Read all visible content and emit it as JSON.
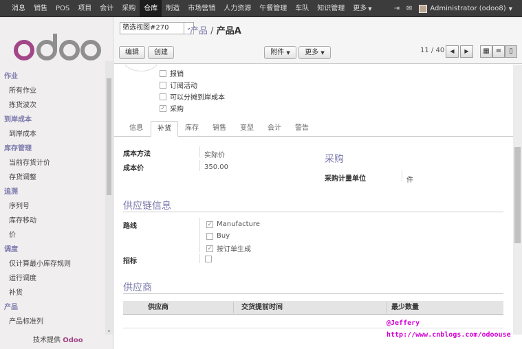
{
  "topnav": {
    "items": [
      "消息",
      "销售",
      "POS",
      "项目",
      "会计",
      "采购",
      "仓库",
      "制造",
      "市场营销",
      "人力资源",
      "午餐管理",
      "车队",
      "知识管理",
      "更多"
    ],
    "active": "仓库",
    "user": "Administrator (odoo8)"
  },
  "sidebar": {
    "logo": "odoo",
    "sections": [
      {
        "title": "作业",
        "items": [
          "所有作业",
          "拣货波次"
        ]
      },
      {
        "title": "到岸成本",
        "items": [
          "到岸成本"
        ]
      },
      {
        "title": "库存管理",
        "items": [
          "当前存货计价",
          "存货调整"
        ]
      },
      {
        "title": "追溯",
        "items": [
          "序列号",
          "库存移动",
          "价"
        ]
      },
      {
        "title": "调度",
        "items": [
          "仅计算最小库存规则",
          "运行调度",
          "补货"
        ]
      },
      {
        "title": "产品",
        "items": [
          "产品标准列"
        ]
      }
    ],
    "footer_prefix": "技术提供",
    "footer_brand": "Odoo"
  },
  "control_panel": {
    "filter_select": "筛选视图#270",
    "breadcrumb_parent": "产品",
    "breadcrumb_sep": "/",
    "breadcrumb_current": "产品A",
    "edit_label": "编辑",
    "create_label": "创建",
    "attachment_label": "附件",
    "more_label": "更多",
    "pager": "11 / 40"
  },
  "form": {
    "checkboxes": [
      {
        "label": "报销",
        "checked": false
      },
      {
        "label": "订阅活动",
        "checked": false
      },
      {
        "label": "可以分摊到岸成本",
        "checked": false
      },
      {
        "label": "采购",
        "checked": true
      }
    ],
    "tabs": [
      "信息",
      "补货",
      "库存",
      "销售",
      "变型",
      "会计",
      "警告"
    ],
    "active_tab": "补货",
    "cost_method_label": "成本方法",
    "cost_method_value": "实际价",
    "cost_price_label": "成本价",
    "cost_price_value": "350.00",
    "purchase_title": "采购",
    "purchase_uom_label": "采购计量单位",
    "purchase_uom_value": "件",
    "supply_chain_title": "供应链信息",
    "routes_label": "路线",
    "routes": [
      {
        "label": "Manufacture",
        "checked": true
      },
      {
        "label": "Buy",
        "checked": false
      },
      {
        "label": "按订单生成",
        "checked": true
      }
    ],
    "tender_label": "招标",
    "suppliers_title": "供应商",
    "supplier_columns": [
      "供应商",
      "交货提前时间",
      "最少数量"
    ]
  },
  "watermark": {
    "line1": "@Jeffery",
    "line2": "http://www.cnblogs.com/odoouse"
  },
  "colors": {
    "accent": "#7c7bad",
    "topbar": "#3c3c3c",
    "watermark": "#d400d4"
  }
}
